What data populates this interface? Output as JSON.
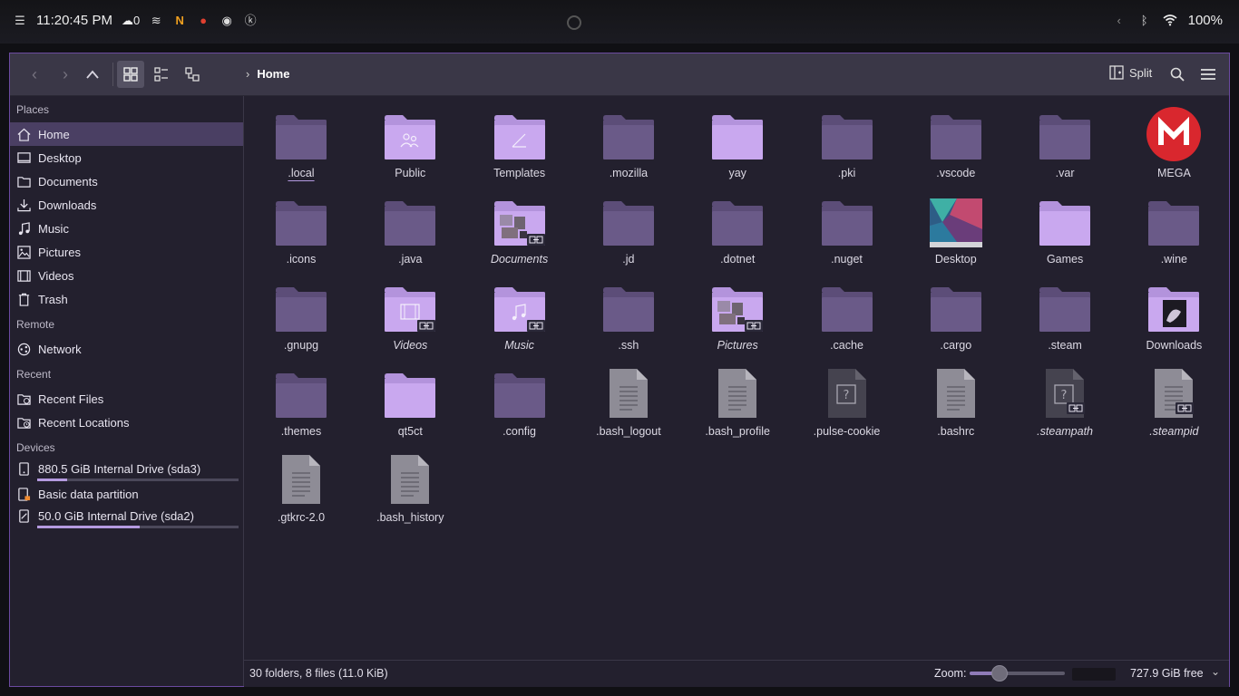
{
  "status_bar": {
    "time": "11:20:45 PM",
    "cloud_count": "0",
    "battery": "100%"
  },
  "toolbar": {
    "breadcrumb": "Home",
    "split_label": "Split"
  },
  "sidebar": {
    "places_label": "Places",
    "places": [
      {
        "label": "Home",
        "icon": "home-icon"
      },
      {
        "label": "Desktop",
        "icon": "desktop-icon"
      },
      {
        "label": "Documents",
        "icon": "documents-icon"
      },
      {
        "label": "Downloads",
        "icon": "downloads-icon"
      },
      {
        "label": "Music",
        "icon": "music-icon"
      },
      {
        "label": "Pictures",
        "icon": "pictures-icon"
      },
      {
        "label": "Videos",
        "icon": "videos-icon"
      },
      {
        "label": "Trash",
        "icon": "trash-icon"
      }
    ],
    "remote_label": "Remote",
    "remote": [
      {
        "label": "Network",
        "icon": "network-icon"
      }
    ],
    "recent_label": "Recent",
    "recent": [
      {
        "label": "Recent Files",
        "icon": "recent-files-icon"
      },
      {
        "label": "Recent Locations",
        "icon": "recent-locations-icon"
      }
    ],
    "devices_label": "Devices",
    "devices": [
      {
        "label": "880.5 GiB Internal Drive (sda3)",
        "usage": 0.15
      },
      {
        "label": "Basic data partition",
        "usage": null
      },
      {
        "label": "50.0 GiB Internal Drive (sda2)",
        "usage": 0.51
      }
    ]
  },
  "files": [
    {
      "name": ".local",
      "kind": "folder-dark"
    },
    {
      "name": "Public",
      "kind": "folder-public"
    },
    {
      "name": "Templates",
      "kind": "folder-templates"
    },
    {
      "name": ".mozilla",
      "kind": "folder-dark"
    },
    {
      "name": "yay",
      "kind": "folder-light"
    },
    {
      "name": ".pki",
      "kind": "folder-dark"
    },
    {
      "name": ".vscode",
      "kind": "folder-dark"
    },
    {
      "name": ".var",
      "kind": "folder-dark"
    },
    {
      "name": "MEGA",
      "kind": "mega"
    },
    {
      "name": ".icons",
      "kind": "folder-dark"
    },
    {
      "name": ".java",
      "kind": "folder-dark"
    },
    {
      "name": "Documents",
      "kind": "folder-link-preview",
      "italic": true
    },
    {
      "name": ".jd",
      "kind": "folder-dark"
    },
    {
      "name": ".dotnet",
      "kind": "folder-dark"
    },
    {
      "name": ".nuget",
      "kind": "folder-dark"
    },
    {
      "name": "Desktop",
      "kind": "wallpaper"
    },
    {
      "name": "Games",
      "kind": "folder-light"
    },
    {
      "name": ".wine",
      "kind": "folder-dark"
    },
    {
      "name": ".gnupg",
      "kind": "folder-dark"
    },
    {
      "name": "Videos",
      "kind": "folder-videos",
      "italic": true
    },
    {
      "name": "Music",
      "kind": "folder-music",
      "italic": true
    },
    {
      "name": ".ssh",
      "kind": "folder-dark"
    },
    {
      "name": "Pictures",
      "kind": "folder-link-preview",
      "italic": true
    },
    {
      "name": ".cache",
      "kind": "folder-dark"
    },
    {
      "name": ".cargo",
      "kind": "folder-dark"
    },
    {
      "name": ".steam",
      "kind": "folder-dark"
    },
    {
      "name": "Downloads",
      "kind": "folder-downloads"
    },
    {
      "name": ".themes",
      "kind": "folder-dark"
    },
    {
      "name": "qt5ct",
      "kind": "folder-light"
    },
    {
      "name": ".config",
      "kind": "folder-dark"
    },
    {
      "name": ".bash_logout",
      "kind": "text-file"
    },
    {
      "name": ".bash_profile",
      "kind": "text-file"
    },
    {
      "name": ".pulse-cookie",
      "kind": "unknown-file"
    },
    {
      "name": ".bashrc",
      "kind": "text-file"
    },
    {
      "name": ".steampath",
      "kind": "unknown-link",
      "italic": true
    },
    {
      "name": ".steampid",
      "kind": "text-link",
      "italic": true
    },
    {
      "name": ".gtkrc-2.0",
      "kind": "text-file"
    },
    {
      "name": ".bash_history",
      "kind": "text-file"
    }
  ],
  "statusline": {
    "summary": "30 folders, 8 files (11.0 KiB)",
    "zoom_label": "Zoom:",
    "zoom_level": 0.3,
    "free_space": "727.9 GiB free"
  }
}
